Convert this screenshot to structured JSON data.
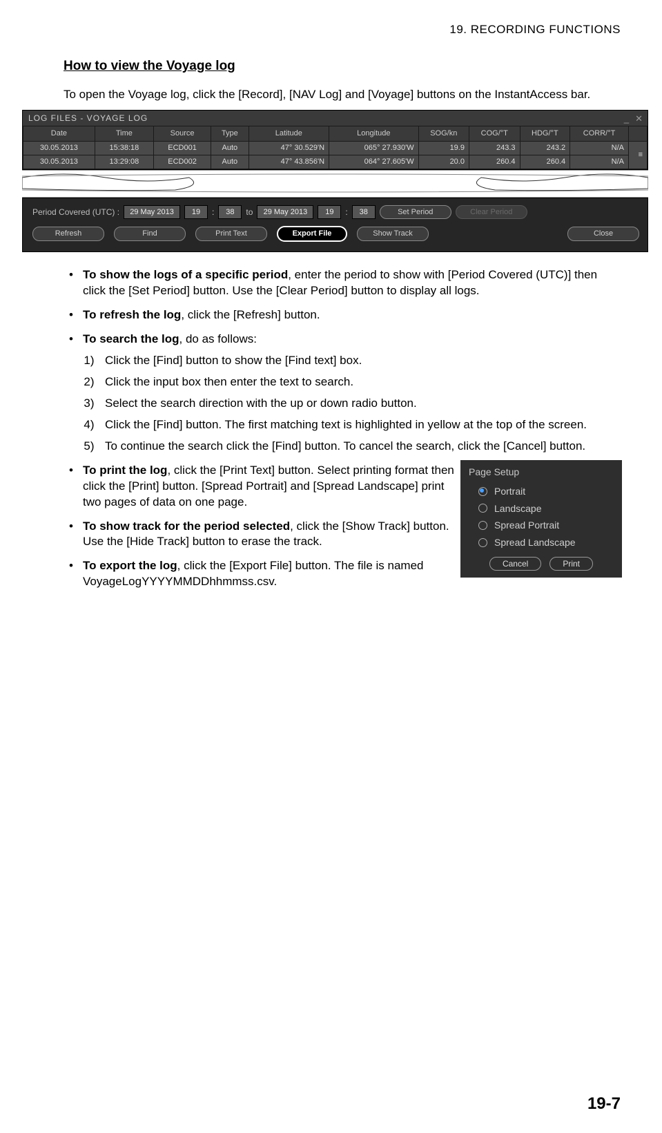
{
  "header": {
    "running_head": "19.  RECORDING FUNCTIONS"
  },
  "title": "How to view the Voyage log",
  "intro": "To open the Voyage log, click the [Record], [NAV Log] and [Voyage] buttons on the InstantAccess bar.",
  "voyage_window": {
    "title": "LOG FILES - VOYAGE LOG",
    "columns": [
      "Date",
      "Time",
      "Source",
      "Type",
      "Latitude",
      "Longitude",
      "SOG/kn",
      "COG/°T",
      "HDG/°T",
      "CORR/°T"
    ],
    "rows": [
      {
        "date": "30.05.2013",
        "time": "15:38:18",
        "source": "ECD001",
        "type": "Auto",
        "lat": "47° 30.529'N",
        "lon": "065° 27.930'W",
        "sog": "19.9",
        "cog": "243.3",
        "hdg": "243.2",
        "corr": "N/A"
      },
      {
        "date": "30.05.2013",
        "time": "13:29:08",
        "source": "ECD002",
        "type": "Auto",
        "lat": "47° 43.856'N",
        "lon": "064° 27.605'W",
        "sog": "20.0",
        "cog": "260.4",
        "hdg": "260.4",
        "corr": "N/A"
      }
    ]
  },
  "controls": {
    "period_label": "Period Covered (UTC) :",
    "from_date": "29 May 2013",
    "from_h": "19",
    "from_m": "38",
    "to_label": "to",
    "to_date": "29 May 2013",
    "to_h": "19",
    "to_m": "38",
    "set_period": "Set Period",
    "clear_period": "Clear Period",
    "refresh": "Refresh",
    "find": "Find",
    "print_text": "Print Text",
    "export_file": "Export File",
    "show_track": "Show Track",
    "close": "Close"
  },
  "bullets": {
    "b1_bold": "To show the logs of a specific period",
    "b1_rest": ", enter the period to show with [Period Covered (UTC)] then click the [Set Period] button. Use the [Clear Period] button to display all logs.",
    "b2_bold": "To refresh the log",
    "b2_rest": ", click the [Refresh] button.",
    "b3_bold": "To search the log",
    "b3_rest": ", do as follows:",
    "steps": [
      "Click the [Find] button to show the [Find text] box.",
      "Click the input box then enter the text to search.",
      "Select the search direction with the up or down radio button.",
      "Click the [Find] button. The first matching text is highlighted in yellow at the top of the screen.",
      "To continue the search click the [Find] button. To cancel the search, click the [Cancel] button."
    ],
    "b4_bold": "To print the log",
    "b4_rest": ", click the [Print Text] button. Select printing format then click the [Print] button. [Spread Portrait] and [Spread Landscape] print two pages of data on one page.",
    "b5_bold": "To show track for the period selected",
    "b5_rest": ", click the [Show Track] button. Use the [Hide Track] button to erase the track.",
    "b6_bold": "To export the log",
    "b6_rest": ", click the [Export File] button. The file is named VoyageLogYYYYMMDDhhmmss.csv."
  },
  "page_setup": {
    "title": "Page Setup",
    "options": [
      "Portrait",
      "Landscape",
      "Spread Portrait",
      "Spread Landscape"
    ],
    "selected": 0,
    "cancel": "Cancel",
    "print": "Print"
  },
  "page_number": "19-7"
}
